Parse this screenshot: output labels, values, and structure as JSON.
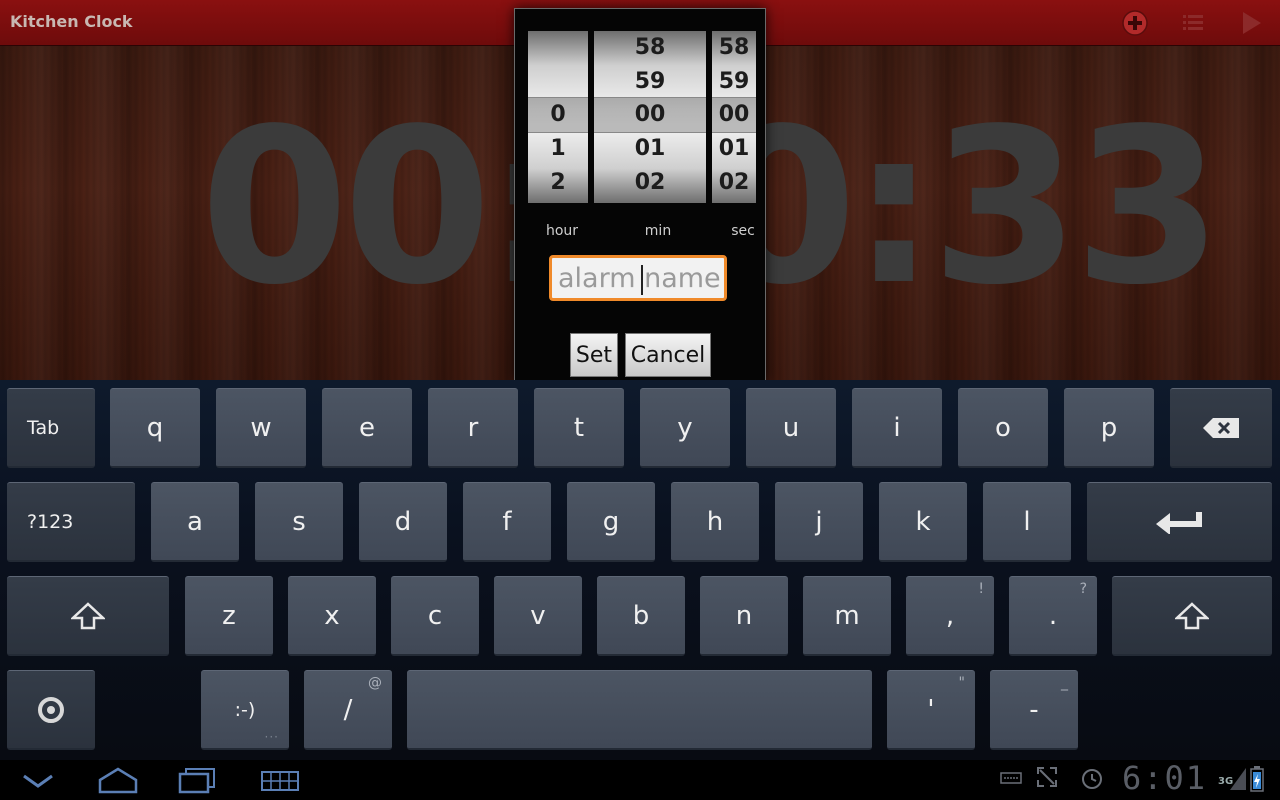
{
  "app": {
    "title": "Kitchen Clock",
    "clock_text": "00:00:33",
    "icons": [
      "add-alarm-icon",
      "list-icon",
      "play-icon"
    ]
  },
  "dialog": {
    "wheels": [
      {
        "label": "hour",
        "items": [
          "",
          "",
          "0",
          "1",
          "2"
        ],
        "selected": "0"
      },
      {
        "label": "min",
        "items": [
          "58",
          "59",
          "00",
          "01",
          "02"
        ],
        "selected": "00"
      },
      {
        "label": "sec",
        "items": [
          "58",
          "59",
          "00",
          "01",
          "02"
        ],
        "selected": "00"
      }
    ],
    "name_placeholder": "alarm name",
    "set_label": "Set",
    "cancel_label": "Cancel",
    "accent_color": "#f08a2a"
  },
  "keyboard": {
    "row1": [
      "Tab",
      "q",
      "w",
      "e",
      "r",
      "t",
      "y",
      "u",
      "i",
      "o",
      "p"
    ],
    "row2": [
      "?123",
      "a",
      "s",
      "d",
      "f",
      "g",
      "h",
      "j",
      "k",
      "l"
    ],
    "row3": [
      "z",
      "x",
      "c",
      "v",
      "b",
      "n",
      "m",
      ",",
      "."
    ],
    "row3_hints": {
      "comma": "!",
      "period": "?"
    },
    "row4": {
      "smiley": ":-)",
      "slash": "/",
      "slash_hint": "@",
      "apostrophe": "'",
      "apostrophe_hint": "\"",
      "dash": "-",
      "dash_hint": "_"
    },
    "icons": [
      "backspace-icon",
      "enter-icon",
      "shift-icon",
      "settings-icon"
    ]
  },
  "system_bar": {
    "time": "6:01",
    "network": "3G",
    "icons": [
      "back-icon",
      "home-icon",
      "recent-apps-icon",
      "keyboard-switch-icon",
      "keyboard-status-icon",
      "screen-compat-icon",
      "alarm-status-icon",
      "signal-icon",
      "battery-icon"
    ]
  }
}
